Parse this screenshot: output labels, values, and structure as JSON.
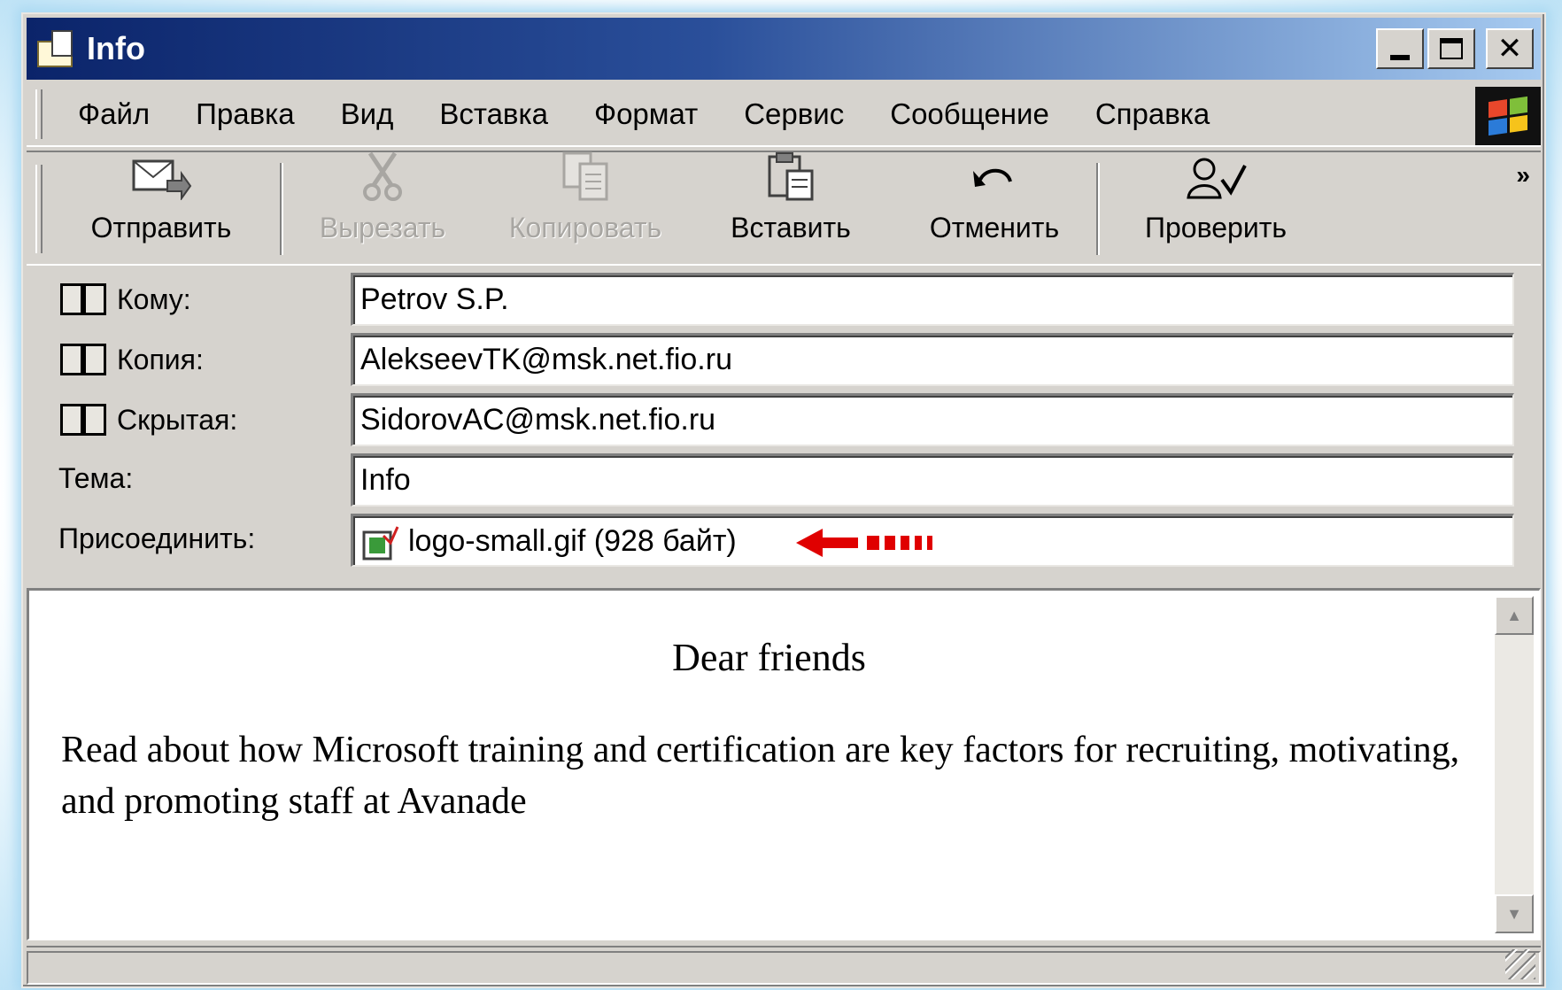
{
  "window": {
    "title": "Info",
    "title_buttons": [
      "minimize",
      "maximize",
      "close"
    ],
    "close_symbol": "✕"
  },
  "menu": {
    "items": [
      "Файл",
      "Правка",
      "Вид",
      "Вставка",
      "Формат",
      "Сервис",
      "Сообщение",
      "Справка"
    ]
  },
  "toolbar": {
    "buttons": [
      {
        "label": "Отправить",
        "icon": "send-icon",
        "enabled": true
      },
      {
        "label": "Вырезать",
        "icon": "scissors-icon",
        "enabled": false
      },
      {
        "label": "Копировать",
        "icon": "copy-icon",
        "enabled": false
      },
      {
        "label": "Вставить",
        "icon": "paste-icon",
        "enabled": true
      },
      {
        "label": "Отменить",
        "icon": "undo-icon",
        "enabled": true
      },
      {
        "label": "Проверить",
        "icon": "check-names-icon",
        "enabled": true
      }
    ],
    "overflow": "»"
  },
  "fields": {
    "to": {
      "label": "Кому:",
      "value": "Petrov S.P."
    },
    "cc": {
      "label": "Копия:",
      "value": "AlekseevTK@msk.net.fio.ru"
    },
    "bcc": {
      "label": "Скрытая:",
      "value": "SidorovAC@msk.net.fio.ru"
    },
    "subject": {
      "label": "Тема:",
      "value": "Info"
    },
    "attach": {
      "label": "Присоединить:",
      "value": "logo-small.gif (928 байт)"
    }
  },
  "message": {
    "greeting": "Dear friends",
    "body": "Read about how Microsoft training and certification are key factors for recruiting, motivating, and promoting staff at Avanade"
  },
  "colors": {
    "titlebar_start": "#0b246a",
    "titlebar_end": "#a6caf0",
    "face": "#d6d3ce",
    "arrow_red": "#e00000"
  }
}
